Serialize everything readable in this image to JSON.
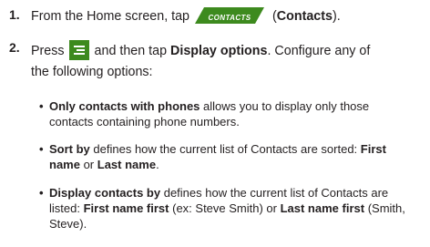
{
  "step1": {
    "number": "1.",
    "prefix": "From the Home screen, tap",
    "icon_label": "CONTACTS",
    "suffix_open": "(",
    "bold": "Contacts",
    "suffix_close": ")."
  },
  "step2": {
    "number": "2.",
    "press": "Press",
    "after_icon": "and then tap",
    "bold": "Display options",
    "rest": ". Configure any of",
    "line2": "the following options:"
  },
  "bullets": [
    {
      "lines": [
        {
          "bold": "Only contacts with phones",
          "text": " allows you to display only those"
        },
        {
          "text": "contacts containing phone numbers."
        }
      ]
    },
    {
      "lines": [
        {
          "bold": "Sort by",
          "text": " defines how the current list of Contacts are sorted: ",
          "bold2": "First"
        },
        {
          "bold": "name",
          "text": " or ",
          "bold2": "Last name",
          "text2": "."
        }
      ]
    },
    {
      "lines": [
        {
          "bold": "Display contacts by",
          "text": " defines how the current list of Contacts are"
        },
        {
          "text": "listed: ",
          "bold": "First name first",
          "text2": " (ex: Steve Smith) or ",
          "bold2": "Last name first",
          "text3": " (Smith,"
        },
        {
          "text": "Steve)."
        }
      ]
    }
  ],
  "colors": {
    "contacts_icon": "#3d8a1e",
    "menu_icon": "#3d8a1e",
    "text": "#231f20"
  }
}
